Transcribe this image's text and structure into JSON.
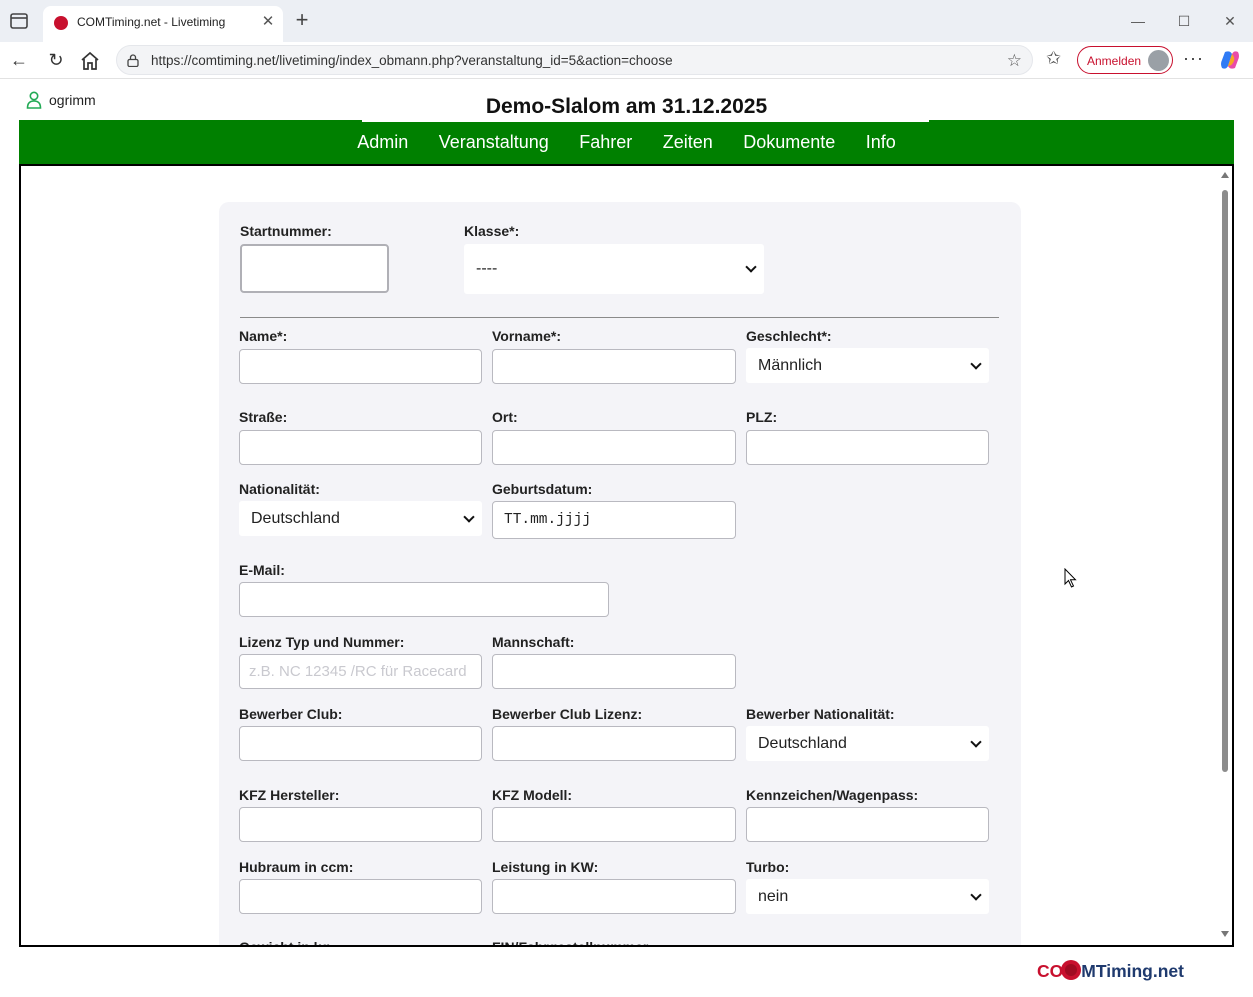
{
  "browser": {
    "tab_title": "COMTiming.net - Livetiming",
    "url": "https://comtiming.net/livetiming/index_obmann.php?veranstaltung_id=5&action=choose",
    "signin_label": "Anmelden"
  },
  "user": {
    "name": "ogrimm"
  },
  "page": {
    "title": "Demo-Slalom am 31.12.2025"
  },
  "nav": [
    "Admin",
    "Veranstaltung",
    "Fahrer",
    "Zeiten",
    "Dokumente",
    "Info"
  ],
  "form": {
    "startnummer": {
      "label": "Startnummer:",
      "value": ""
    },
    "klasse": {
      "label": "Klasse*:",
      "value": "----"
    },
    "name": {
      "label": "Name*:",
      "value": ""
    },
    "vorname": {
      "label": "Vorname*:",
      "value": ""
    },
    "geschlecht": {
      "label": "Geschlecht*:",
      "value": "Männlich"
    },
    "strasse": {
      "label": "Straße:",
      "value": ""
    },
    "ort": {
      "label": "Ort:",
      "value": ""
    },
    "plz": {
      "label": "PLZ:",
      "value": ""
    },
    "nationalitaet": {
      "label": "Nationalität:",
      "value": "Deutschland"
    },
    "geburtsdatum": {
      "label": "Geburtsdatum:",
      "value": "TT.mm.jjjj"
    },
    "email": {
      "label": "E-Mail:",
      "value": ""
    },
    "lizenz": {
      "label": "Lizenz Typ und Nummer:",
      "placeholder": "z.B. NC 12345 /RC für Racecard"
    },
    "mannschaft": {
      "label": "Mannschaft:",
      "value": ""
    },
    "bewerber_club": {
      "label": "Bewerber Club:",
      "value": ""
    },
    "bewerber_club_lizenz": {
      "label": "Bewerber Club Lizenz:",
      "value": ""
    },
    "bewerber_nationalitaet": {
      "label": "Bewerber Nationalität:",
      "value": "Deutschland"
    },
    "kfz_hersteller": {
      "label": "KFZ Hersteller:",
      "value": ""
    },
    "kfz_modell": {
      "label": "KFZ Modell:",
      "value": ""
    },
    "kennzeichen": {
      "label": "Kennzeichen/Wagenpass:",
      "value": ""
    },
    "hubraum": {
      "label": "Hubraum in ccm:",
      "value": ""
    },
    "leistung": {
      "label": "Leistung in KW:",
      "value": ""
    },
    "turbo": {
      "label": "Turbo:",
      "value": "nein"
    },
    "gewicht": {
      "label": "Gewicht in kg:"
    },
    "fin": {
      "label": "FIN/Fahrgestellnummer:"
    }
  },
  "footer": {
    "logo_prefix": "CO",
    "logo_suffix": "MTiming.net"
  },
  "colors": {
    "nav_green": "#008000",
    "brand_red": "#c8102e",
    "brand_navy": "#1f3a6e"
  }
}
